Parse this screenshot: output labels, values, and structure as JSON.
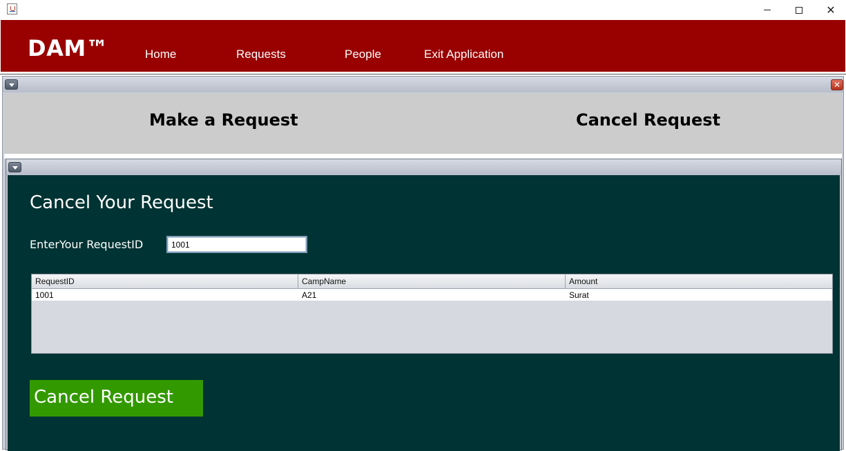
{
  "window": {
    "minimize_glyph": "",
    "close_glyph": "✕"
  },
  "menubar": {
    "brand": "DAM™",
    "items": [
      "Home",
      "Requests",
      "People",
      "Exit Application"
    ],
    "color": "#990000"
  },
  "outer_frame": {
    "close_glyph": "✕",
    "tabs": [
      "Make a Request",
      "Cancel Request"
    ]
  },
  "cancel_form": {
    "heading": "Cancel Your Request",
    "request_id_label": "EnterYour RequestID",
    "request_id_value": "1001",
    "table": {
      "columns": [
        "RequestID",
        "CampName",
        "Amount"
      ],
      "rows": [
        [
          "1001",
          "A21",
          "Surat"
        ]
      ]
    },
    "submit_label": "Cancel Request",
    "background": "#003333",
    "button_color": "#339900"
  }
}
